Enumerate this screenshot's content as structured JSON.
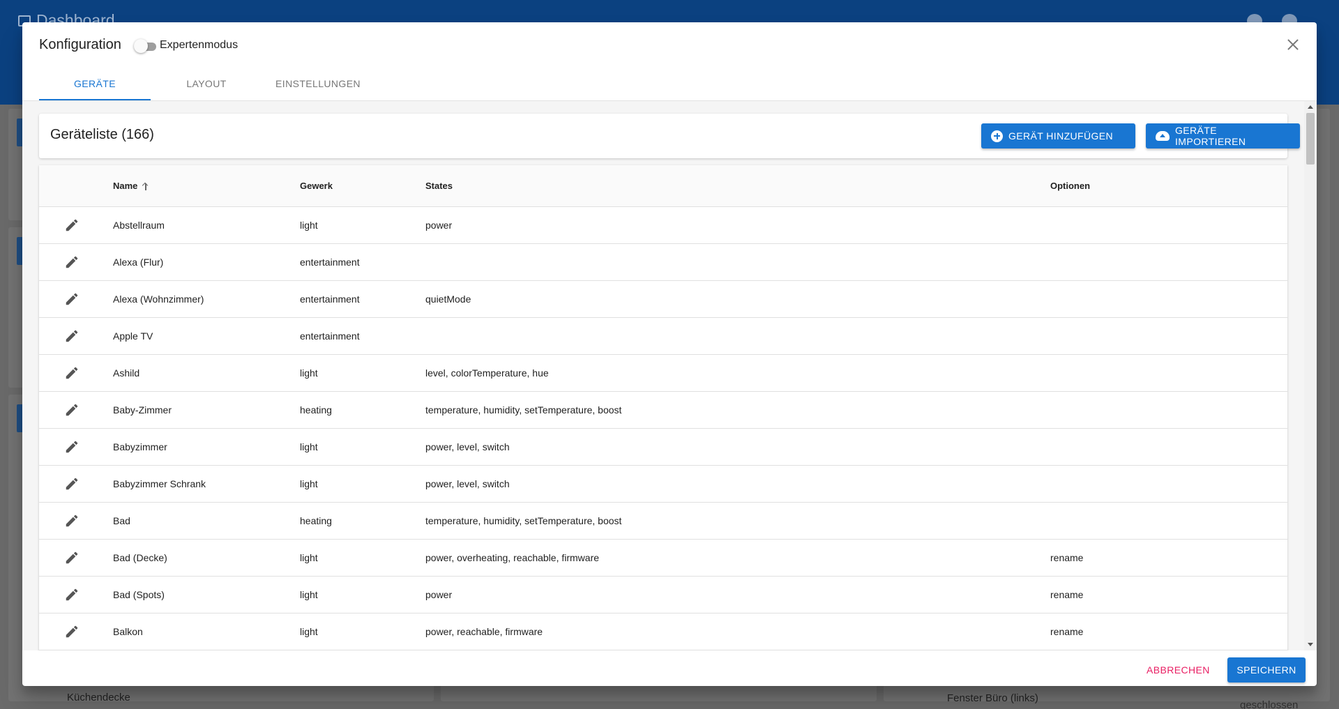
{
  "background": {
    "app_title": "Dashboard",
    "items": [
      {
        "label": "Küchendecke"
      },
      {
        "label": "Fenster Büro (links)",
        "status": "geschlossen"
      }
    ]
  },
  "dialog": {
    "title": "Konfiguration",
    "expert_mode_label": "Expertenmodus",
    "expert_mode_on": false,
    "tabs": [
      {
        "label": "Geräte",
        "active": true
      },
      {
        "label": "Layout",
        "active": false
      },
      {
        "label": "Einstellungen",
        "active": false
      }
    ],
    "list_title": "Geräteliste (166)",
    "add_button": "Gerät hinzufügen",
    "import_button": "Geräte importieren",
    "columns": {
      "name": "Name",
      "gewerk": "Gewerk",
      "states": "States",
      "options": "Optionen"
    },
    "rows": [
      {
        "name": "Abstellraum",
        "gewerk": "light",
        "states": "power",
        "options": ""
      },
      {
        "name": "Alexa (Flur)",
        "gewerk": "entertainment",
        "states": "",
        "options": ""
      },
      {
        "name": "Alexa (Wohnzimmer)",
        "gewerk": "entertainment",
        "states": "quietMode",
        "options": ""
      },
      {
        "name": "Apple TV",
        "gewerk": "entertainment",
        "states": "",
        "options": ""
      },
      {
        "name": "Ashild",
        "gewerk": "light",
        "states": "level, colorTemperature, hue",
        "options": ""
      },
      {
        "name": "Baby-Zimmer",
        "gewerk": "heating",
        "states": "temperature, humidity, setTemperature, boost",
        "options": ""
      },
      {
        "name": "Babyzimmer",
        "gewerk": "light",
        "states": "power, level, switch",
        "options": ""
      },
      {
        "name": "Babyzimmer Schrank",
        "gewerk": "light",
        "states": "power, level, switch",
        "options": ""
      },
      {
        "name": "Bad",
        "gewerk": "heating",
        "states": "temperature, humidity, setTemperature, boost",
        "options": ""
      },
      {
        "name": "Bad (Decke)",
        "gewerk": "light",
        "states": "power, overheating, reachable, firmware",
        "options": "rename"
      },
      {
        "name": "Bad (Spots)",
        "gewerk": "light",
        "states": "power",
        "options": "rename"
      },
      {
        "name": "Balkon",
        "gewerk": "light",
        "states": "power, reachable, firmware",
        "options": "rename"
      }
    ],
    "cancel_button": "Abbrechen",
    "save_button": "Speichern"
  },
  "colors": {
    "primary": "#1976d2",
    "cancel": "#e91e63",
    "app_bar": "#0b4180"
  },
  "icons": {
    "edit": "pencil-icon",
    "close": "close-icon",
    "add": "add-circle-icon",
    "import": "cloud-upload-icon",
    "sort": "arrow-up-icon"
  }
}
